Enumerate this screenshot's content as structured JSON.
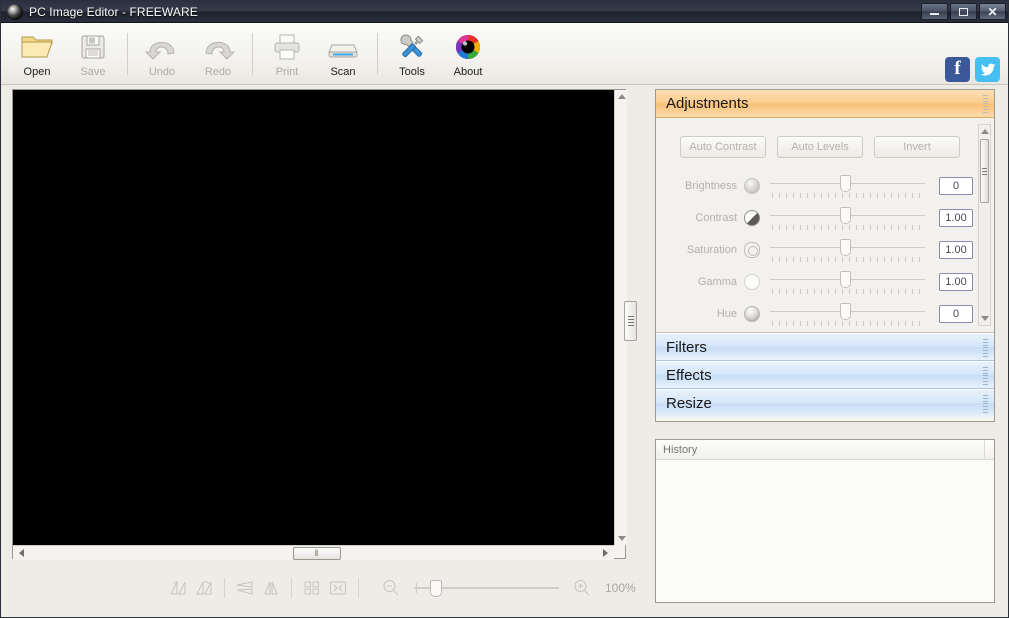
{
  "window": {
    "title": "PC Image Editor - FREEWARE",
    "app_icon": "app-logo-icon",
    "minimize_label": "Minimize",
    "maximize_label": "Maximize",
    "close_label": "Close"
  },
  "toolbar": {
    "items": [
      {
        "label": "Open",
        "icon": "open-folder-icon",
        "disabled": false
      },
      {
        "label": "Save",
        "icon": "floppy-disk-icon",
        "disabled": true
      },
      {
        "label": "Undo",
        "icon": "undo-arrow-icon",
        "disabled": true
      },
      {
        "label": "Redo",
        "icon": "redo-arrow-icon",
        "disabled": true
      },
      {
        "label": "Print",
        "icon": "printer-icon",
        "disabled": true
      },
      {
        "label": "Scan",
        "icon": "scanner-icon",
        "disabled": false
      },
      {
        "label": "Tools",
        "icon": "tools-icon",
        "disabled": false
      },
      {
        "label": "About",
        "icon": "color-wheel-icon",
        "disabled": false
      }
    ],
    "social": [
      {
        "name": "facebook-icon",
        "glyph": "f",
        "color": "#3b5998"
      },
      {
        "name": "twitter-icon",
        "glyph": "🐦",
        "color": "#46c0f3"
      }
    ]
  },
  "canvas": {
    "background_color": "#000000",
    "h_scroll_grip": "‖"
  },
  "bottom_toolbar": {
    "icons": [
      {
        "name": "rotate-left-icon"
      },
      {
        "name": "rotate-right-icon"
      },
      {
        "name": "flip-vertical-icon"
      },
      {
        "name": "flip-horizontal-icon"
      },
      {
        "name": "tile-icon"
      },
      {
        "name": "fit-to-screen-icon"
      },
      {
        "name": "zoom-out-icon"
      },
      {
        "name": "zoom-in-icon"
      }
    ],
    "zoom_level": "100%"
  },
  "right_panel": {
    "sections": [
      {
        "label": "Adjustments",
        "state": "open"
      },
      {
        "label": "Filters",
        "state": "closed"
      },
      {
        "label": "Effects",
        "state": "closed"
      },
      {
        "label": "Resize",
        "state": "closed"
      }
    ],
    "adjustments": {
      "buttons": [
        {
          "label": "Auto Contrast"
        },
        {
          "label": "Auto Levels"
        },
        {
          "label": "Invert"
        }
      ],
      "sliders": [
        {
          "label": "Brightness",
          "icon": "brightness-icon",
          "value": "0",
          "thumb_pct": 45
        },
        {
          "label": "Contrast",
          "icon": "contrast-icon",
          "value": "1.00",
          "thumb_pct": 45
        },
        {
          "label": "Saturation",
          "icon": "saturation-icon",
          "value": "1.00",
          "thumb_pct": 45
        },
        {
          "label": "Gamma",
          "icon": "gamma-icon",
          "value": "1.00",
          "thumb_pct": 45
        },
        {
          "label": "Hue",
          "icon": "hue-icon",
          "value": "0",
          "thumb_pct": 45
        }
      ]
    }
  },
  "history": {
    "column_header": "History",
    "rows": []
  },
  "colors": {
    "titlebar": "#2b3140",
    "accent_open_header": "#f8bf74",
    "accent_closed_header": "#c6dcf4",
    "toolbar_bg": "#f3f2ee",
    "canvas": "#000000",
    "spinner_border": "#8c8ab2"
  }
}
